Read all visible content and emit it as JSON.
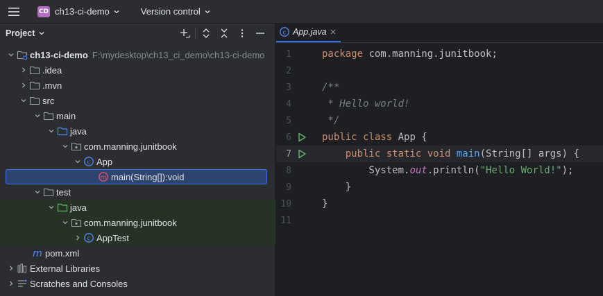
{
  "titlebar": {
    "project_badge": "CD",
    "project_name": "ch13-ci-demo",
    "vcs_label": "Version control"
  },
  "project_panel": {
    "title": "Project",
    "tree": [
      {
        "label": "ch13-ci-demo",
        "path": "F:\\mydesktop\\ch13_ci_demo\\ch13-ci-demo",
        "icon": "module-folder-icon"
      },
      {
        "label": ".idea",
        "icon": "folder-icon"
      },
      {
        "label": ".mvn",
        "icon": "folder-icon"
      },
      {
        "label": "src",
        "icon": "folder-icon"
      },
      {
        "label": "main",
        "icon": "folder-icon"
      },
      {
        "label": "java",
        "icon": "source-folder-icon"
      },
      {
        "label": "com.manning.junitbook",
        "icon": "package-icon"
      },
      {
        "label": "App",
        "icon": "class-icon"
      },
      {
        "label": "main(String[]):void",
        "icon": "method-icon"
      },
      {
        "label": "test",
        "icon": "folder-icon"
      },
      {
        "label": "java",
        "icon": "test-source-folder-icon"
      },
      {
        "label": "com.manning.junitbook",
        "icon": "package-icon"
      },
      {
        "label": "AppTest",
        "icon": "class-icon"
      },
      {
        "label": "pom.xml",
        "icon": "maven-icon"
      },
      {
        "label": "External Libraries",
        "icon": "library-icon"
      },
      {
        "label": "Scratches and Consoles",
        "icon": "scratches-icon"
      }
    ]
  },
  "editor": {
    "tab_label": "App.java",
    "line_numbers": [
      "1",
      "2",
      "3",
      "4",
      "5",
      "6",
      "7",
      "8",
      "9",
      "10",
      "11"
    ],
    "code": {
      "l1_kw": "package",
      "l1_rest": " com.manning.junitbook;",
      "l3": "/**",
      "l4": " * Hello world!",
      "l5": " */",
      "l6_kw": "public class",
      "l6_rest": " App {",
      "l7_indent": "    ",
      "l7_kw": "public static void",
      "l7_sp": " ",
      "l7_fn": "main",
      "l7_rest": "(String[] args) {",
      "l8_a": "        System.",
      "l8_field": "out",
      "l8_b": ".println(",
      "l8_str": "\"Hello World!\"",
      "l8_c": ");",
      "l9": "    }",
      "l10": "}"
    }
  },
  "colors": {
    "accent": "#3574f0",
    "keyword": "#cf8e6d",
    "string": "#6aab73",
    "function": "#56a8f5",
    "comment": "#7a7e85",
    "run_gutter": "#5fb865",
    "test_folder_bg": "#273226"
  }
}
